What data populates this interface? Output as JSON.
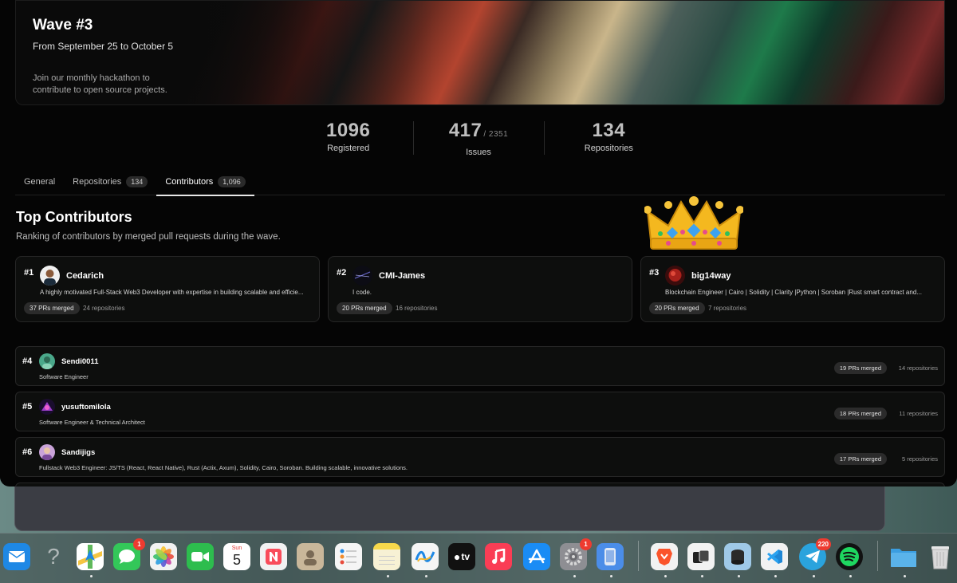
{
  "banner": {
    "title": "Wave #3",
    "dates": "From September 25 to October 5",
    "description": "Join our monthly hackathon to contribute to open source projects."
  },
  "stats": [
    {
      "value": "1096",
      "sub": "",
      "label": "Registered"
    },
    {
      "value": "417",
      "sub": "/ 2351",
      "label": "Issues"
    },
    {
      "value": "134",
      "sub": "",
      "label": "Repositories"
    }
  ],
  "tabs": [
    {
      "label": "General",
      "badge": ""
    },
    {
      "label": "Repositories",
      "badge": "134"
    },
    {
      "label": "Contributors",
      "badge": "1,096"
    }
  ],
  "section": {
    "title": "Top Contributors",
    "subtitle": "Ranking of contributors by merged pull requests during the wave."
  },
  "top": [
    {
      "rank": "#1",
      "name": "Cedarich",
      "bio": "A highly motivated Full-Stack Web3 Developer with expertise in building scalable and efficie...",
      "prs": "37 PRs merged",
      "repos": "24 repositories"
    },
    {
      "rank": "#2",
      "name": "CMI-James",
      "bio": "I code.",
      "prs": "20 PRs merged",
      "repos": "16 repositories"
    },
    {
      "rank": "#3",
      "name": "big14way",
      "bio": "Blockchain Engineer | Cairo | Solidity | Clarity |Python | Soroban |Rust smart contract and...",
      "prs": "20 PRs merged",
      "repos": "7 repositories"
    }
  ],
  "rows": [
    {
      "rank": "#4",
      "name": "Sendi0011",
      "bio": "Software Engineer",
      "prs": "19 PRs merged",
      "repos": "14 repositories"
    },
    {
      "rank": "#5",
      "name": "yusuftomilola",
      "bio": "Software Engineer & Technical Architect",
      "prs": "18 PRs merged",
      "repos": "11 repositories"
    },
    {
      "rank": "#6",
      "name": "Sandijigs",
      "bio": "Fullstack Web3 Engineer: JS/TS (React, React Native), Rust (Actix, Axum), Solidity, Cairo, Soroban. Building scalable, innovative solutions.",
      "prs": "17 PRs merged",
      "repos": "5 repositories"
    }
  ],
  "dock": {
    "calendar_month": "Sun",
    "calendar_day": "5",
    "tv_label": "tv",
    "badges": {
      "messages": "1",
      "settings": "1",
      "telegram": "220"
    },
    "items": [
      {
        "name": "mail-icon",
        "color": "#1e88e5"
      },
      {
        "name": "help-icon",
        "color": "transparent"
      },
      {
        "name": "maps-icon",
        "color": "#5fb85b"
      },
      {
        "name": "messages-icon",
        "color": "#33c759"
      },
      {
        "name": "photos-icon",
        "color": "#f2f2f2"
      },
      {
        "name": "facetime-icon",
        "color": "#2dbd4e"
      },
      {
        "name": "calendar-icon",
        "color": "#ffffff"
      },
      {
        "name": "news-icon",
        "color": "#f2f2f2"
      },
      {
        "name": "contacts-icon",
        "color": "#c9b79a"
      },
      {
        "name": "reminders-icon",
        "color": "#f5f5f5"
      },
      {
        "name": "notes-icon",
        "color": "#f7d84b"
      },
      {
        "name": "freeform-icon",
        "color": "#f5f5f5"
      },
      {
        "name": "apple-tv-icon",
        "color": "#111111"
      },
      {
        "name": "music-icon",
        "color": "#fa3d55"
      },
      {
        "name": "app-store-icon",
        "color": "#1a8cf5"
      },
      {
        "name": "settings-icon",
        "color": "#8e8e93"
      },
      {
        "name": "simulator-icon",
        "color": "#4b8de8"
      },
      {
        "name": "brave-icon",
        "color": "#f2f2f2"
      },
      {
        "name": "dashboard-icon",
        "color": "#f2f2f2"
      },
      {
        "name": "finder-drive-icon",
        "color": "#9fc9e8"
      },
      {
        "name": "vscode-icon",
        "color": "#f2f2f2"
      },
      {
        "name": "telegram-icon",
        "color": "#2aa3dd"
      },
      {
        "name": "spotify-icon",
        "color": "#111111"
      },
      {
        "name": "folder-icon",
        "color": "#5ab3ea"
      },
      {
        "name": "trash-icon",
        "color": "#d9d9d9"
      }
    ]
  }
}
